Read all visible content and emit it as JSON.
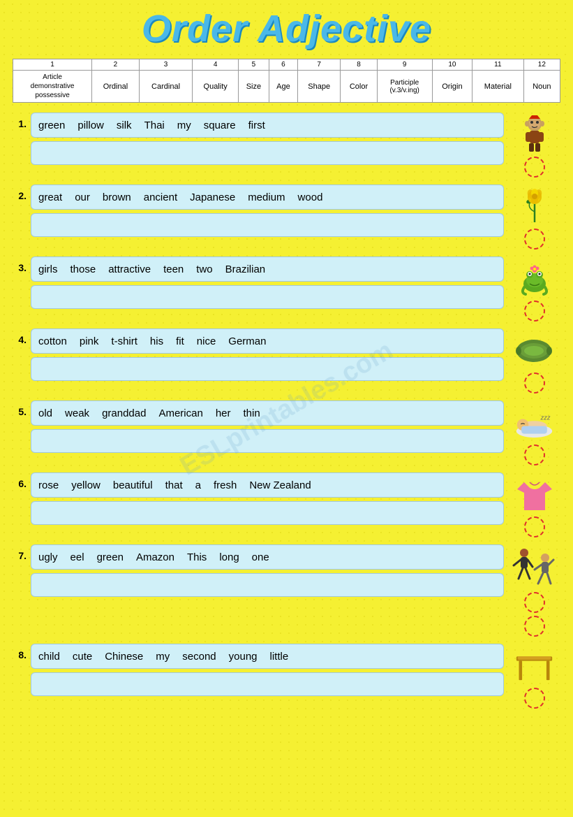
{
  "title": "Order Adjective",
  "watermark": "ESLprintables.com",
  "header": {
    "columns": [
      {
        "num": "1",
        "label": "Article\ndemonstrative\npossessive"
      },
      {
        "num": "2",
        "label": "Ordinal"
      },
      {
        "num": "3",
        "label": "Cardinal"
      },
      {
        "num": "4",
        "label": "Quality"
      },
      {
        "num": "5",
        "label": "Size"
      },
      {
        "num": "6",
        "label": "Age"
      },
      {
        "num": "7",
        "label": "Shape"
      },
      {
        "num": "8",
        "label": "Color"
      },
      {
        "num": "9",
        "label": "Participle\n(v.3/v.ing)"
      },
      {
        "num": "10",
        "label": "Origin"
      },
      {
        "num": "11",
        "label": "Material"
      },
      {
        "num": "12",
        "label": "Noun"
      }
    ]
  },
  "exercises": [
    {
      "number": "1.",
      "words": [
        "green",
        "pillow",
        "silk",
        "Thai",
        "my",
        "square",
        "first"
      ],
      "image_type": "troll"
    },
    {
      "number": "2.",
      "words": [
        "great",
        "our",
        "brown",
        "ancient",
        "Japanese",
        "medium",
        "wood"
      ],
      "image_type": "rose"
    },
    {
      "number": "3.",
      "words": [
        "girls",
        "those",
        "attractive",
        "teen",
        "two",
        "Brazilian"
      ],
      "image_type": "frog"
    },
    {
      "number": "4.",
      "words": [
        "cotton",
        "pink",
        "t-shirt",
        "his",
        "fit",
        "nice",
        "German"
      ],
      "image_type": "pillow"
    },
    {
      "number": "5.",
      "words": [
        "old",
        "weak",
        "granddad",
        "American",
        "her",
        "thin"
      ],
      "image_type": "baby"
    },
    {
      "number": "6.",
      "words": [
        "rose",
        "yellow",
        "beautiful",
        "that",
        "a",
        "fresh",
        "New Zealand"
      ],
      "image_type": "tshirt"
    },
    {
      "number": "7.",
      "words": [
        "ugly",
        "eel",
        "green",
        "Amazon",
        "This",
        "long",
        "one"
      ],
      "image_type": "dancers"
    },
    {
      "number": "8.",
      "words": [
        "child",
        "cute",
        "Chinese",
        "my",
        "second",
        "young",
        "little"
      ],
      "image_type": "table"
    }
  ]
}
